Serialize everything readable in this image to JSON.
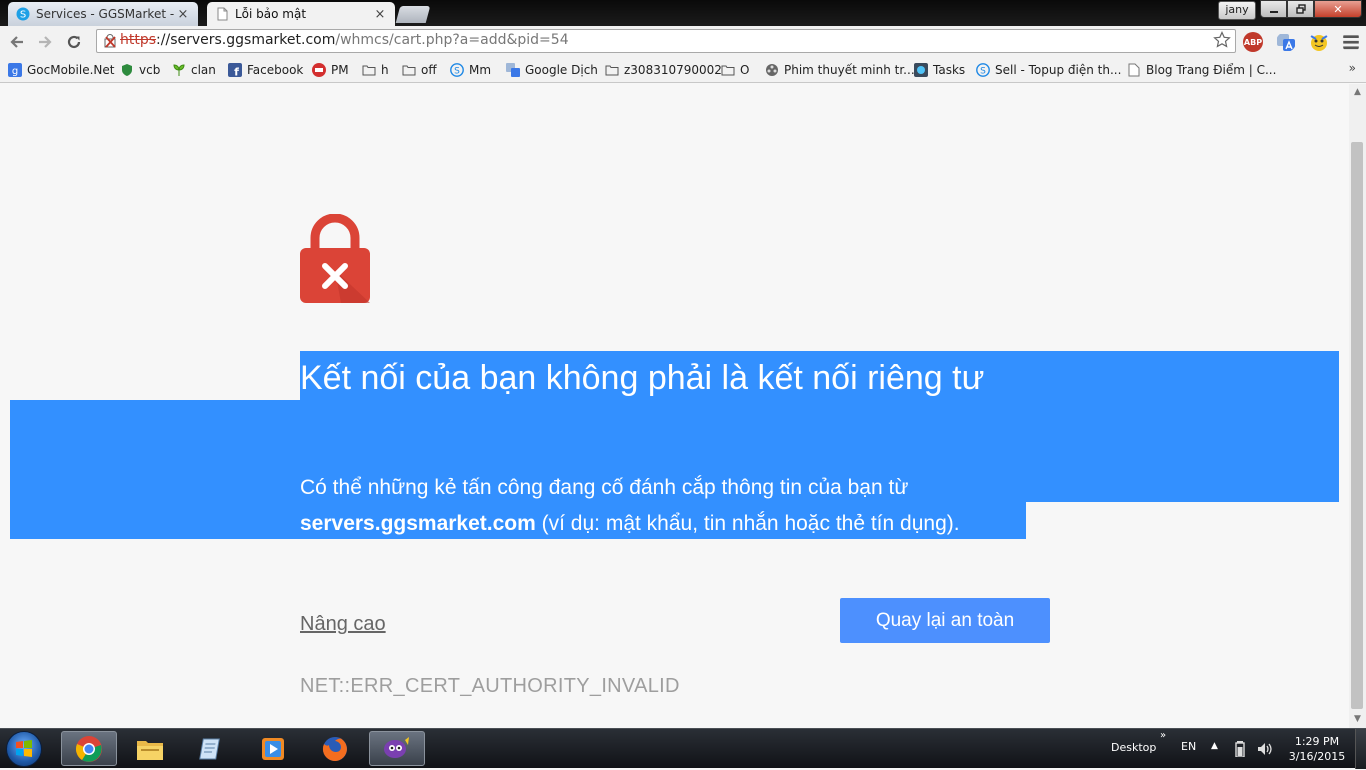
{
  "browser": {
    "tabs": [
      {
        "label": "Services - GGSMarket - Vi",
        "close": "×",
        "active": false
      },
      {
        "label": "Lỗi bảo mật",
        "close": "×",
        "active": true
      }
    ],
    "user_badge": "jany",
    "window_controls": {
      "close": "✕"
    },
    "url": {
      "scheme": "https",
      "host": "://servers.ggsmarket.com",
      "path": "/whmcs/cart.php?a=add&pid=54"
    },
    "icons": [
      "back-icon",
      "forward-icon",
      "reload-icon",
      "insecure-lock-icon",
      "bookmark-star-icon",
      "adblock-icon",
      "translate-icon",
      "extension-icon",
      "menu-icon"
    ],
    "extensions": {
      "adblock": "ABP"
    }
  },
  "bookmarks": [
    {
      "label": "GocMobile.Net",
      "icon": "google-icon"
    },
    {
      "label": "vcb",
      "icon": "shield-icon"
    },
    {
      "label": "clan",
      "icon": "leaf-icon"
    },
    {
      "label": "Facebook",
      "icon": "facebook-icon"
    },
    {
      "label": "PM",
      "icon": "pm-icon"
    },
    {
      "label": "h",
      "icon": "folder-icon"
    },
    {
      "label": "off",
      "icon": "folder-icon"
    },
    {
      "label": "Mm",
      "icon": "skype-icon"
    },
    {
      "label": "Google Dịch",
      "icon": "translate-icon"
    },
    {
      "label": "z308310790002",
      "icon": "folder-icon"
    },
    {
      "label": "O",
      "icon": "folder-icon"
    },
    {
      "label": "Phim thuyết minh tr...",
      "icon": "film-icon"
    },
    {
      "label": "Tasks",
      "icon": "tasks-icon"
    },
    {
      "label": "Sell - Topup điện th...",
      "icon": "skype-icon"
    },
    {
      "label": "Blog Trang Điểm | C...",
      "icon": "page-icon"
    }
  ],
  "bookmarks_more": "»",
  "interstitial": {
    "heading": "Kết nối của bạn không phải là kết nối riêng tư",
    "body_prefix": "Có thể những kẻ tấn công đang cố đánh cắp thông tin của bạn từ ",
    "body_host": "servers.ggsmarket.com",
    "body_suffix": " (ví dụ: mật khẩu, tin nhắn hoặc thẻ tín dụng).",
    "advanced_label": "Nâng cao",
    "back_button_label": "Quay lại an toàn",
    "error_code": "NET::ERR_CERT_AUTHORITY_INVALID",
    "selection_color": "#3390ff",
    "button_color": "#4d90fe",
    "lock_color": "#db4437"
  },
  "taskbar": {
    "apps": [
      "chrome-icon",
      "file-explorer-icon",
      "notepad-icon",
      "media-player-icon",
      "firefox-icon",
      "messenger-icon"
    ],
    "desktop_label": "Desktop",
    "language": "EN",
    "time": "1:29 PM",
    "date": "3/16/2015"
  }
}
